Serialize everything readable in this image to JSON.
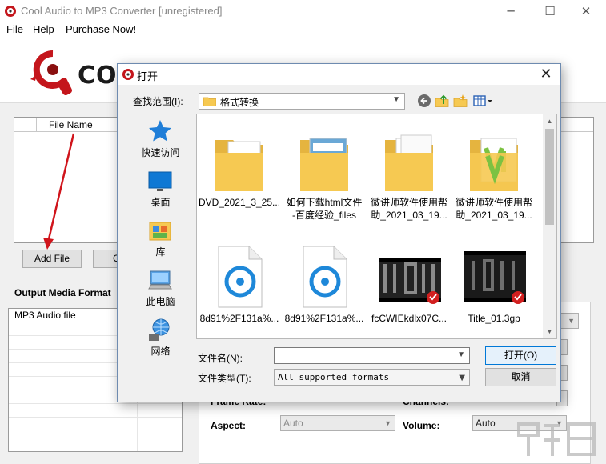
{
  "window": {
    "title": "Cool Audio to MP3 Converter  [unregistered]",
    "controls": {
      "minimize": "─",
      "maximize": "☐",
      "close": "✕"
    }
  },
  "menu": [
    "File",
    "Help",
    "Purchase Now!"
  ],
  "banner": {
    "text_visible": "CO"
  },
  "file_list": {
    "columns": [
      "",
      "File Name"
    ]
  },
  "buttons": {
    "add_file": "Add File",
    "second_partial": "C"
  },
  "output_format": {
    "label": "Output Media Format",
    "items": [
      "MP3 Audio file"
    ]
  },
  "settings": {
    "frame_rate_partial": "Frame Rate:",
    "channels_partial": "Channels:",
    "aspect_label": "Aspect:",
    "aspect_value": "Auto",
    "volume_label": "Volume:",
    "volume_value": "Auto"
  },
  "dialog": {
    "title": "打开",
    "close": "✕",
    "lookin_label": "查找范围(I):",
    "lookin_value": "格式转换",
    "toolbar_icons": [
      "back-icon",
      "up-folder-icon",
      "new-folder-icon",
      "view-menu-icon"
    ],
    "places": [
      {
        "label": "快速访问",
        "icon": "star-icon"
      },
      {
        "label": "桌面",
        "icon": "desktop-icon"
      },
      {
        "label": "库",
        "icon": "library-icon"
      },
      {
        "label": "此电脑",
        "icon": "computer-icon"
      },
      {
        "label": "网络",
        "icon": "network-icon"
      }
    ],
    "files": [
      {
        "line1": "DVD_2021_3_25...",
        "line2": "",
        "kind": "folder"
      },
      {
        "line1": "如何下载html文件",
        "line2": "-百度经验_files",
        "kind": "folder"
      },
      {
        "line1": "微讲师软件使用帮",
        "line2": "助_2021_03_19...",
        "kind": "folder"
      },
      {
        "line1": "微讲师软件使用帮",
        "line2": "助_2021_03_19...",
        "kind": "folder"
      },
      {
        "line1": "8d91%2F131a%...",
        "line2": "",
        "kind": "media"
      },
      {
        "line1": "8d91%2F131a%...",
        "line2": "",
        "kind": "media"
      },
      {
        "line1": "fcCWIEkdlx07C...",
        "line2": "",
        "kind": "video"
      },
      {
        "line1": "Title_01.3gp",
        "line2": "",
        "kind": "video"
      }
    ],
    "filename_label": "文件名(N):",
    "filename_value": "",
    "filetype_label": "文件类型(T):",
    "filetype_value": "All supported formats",
    "open_button": "打开(O)",
    "cancel_button": "取消"
  },
  "colors": {
    "accent": "#0078d7",
    "logo_red": "#c4161c"
  }
}
